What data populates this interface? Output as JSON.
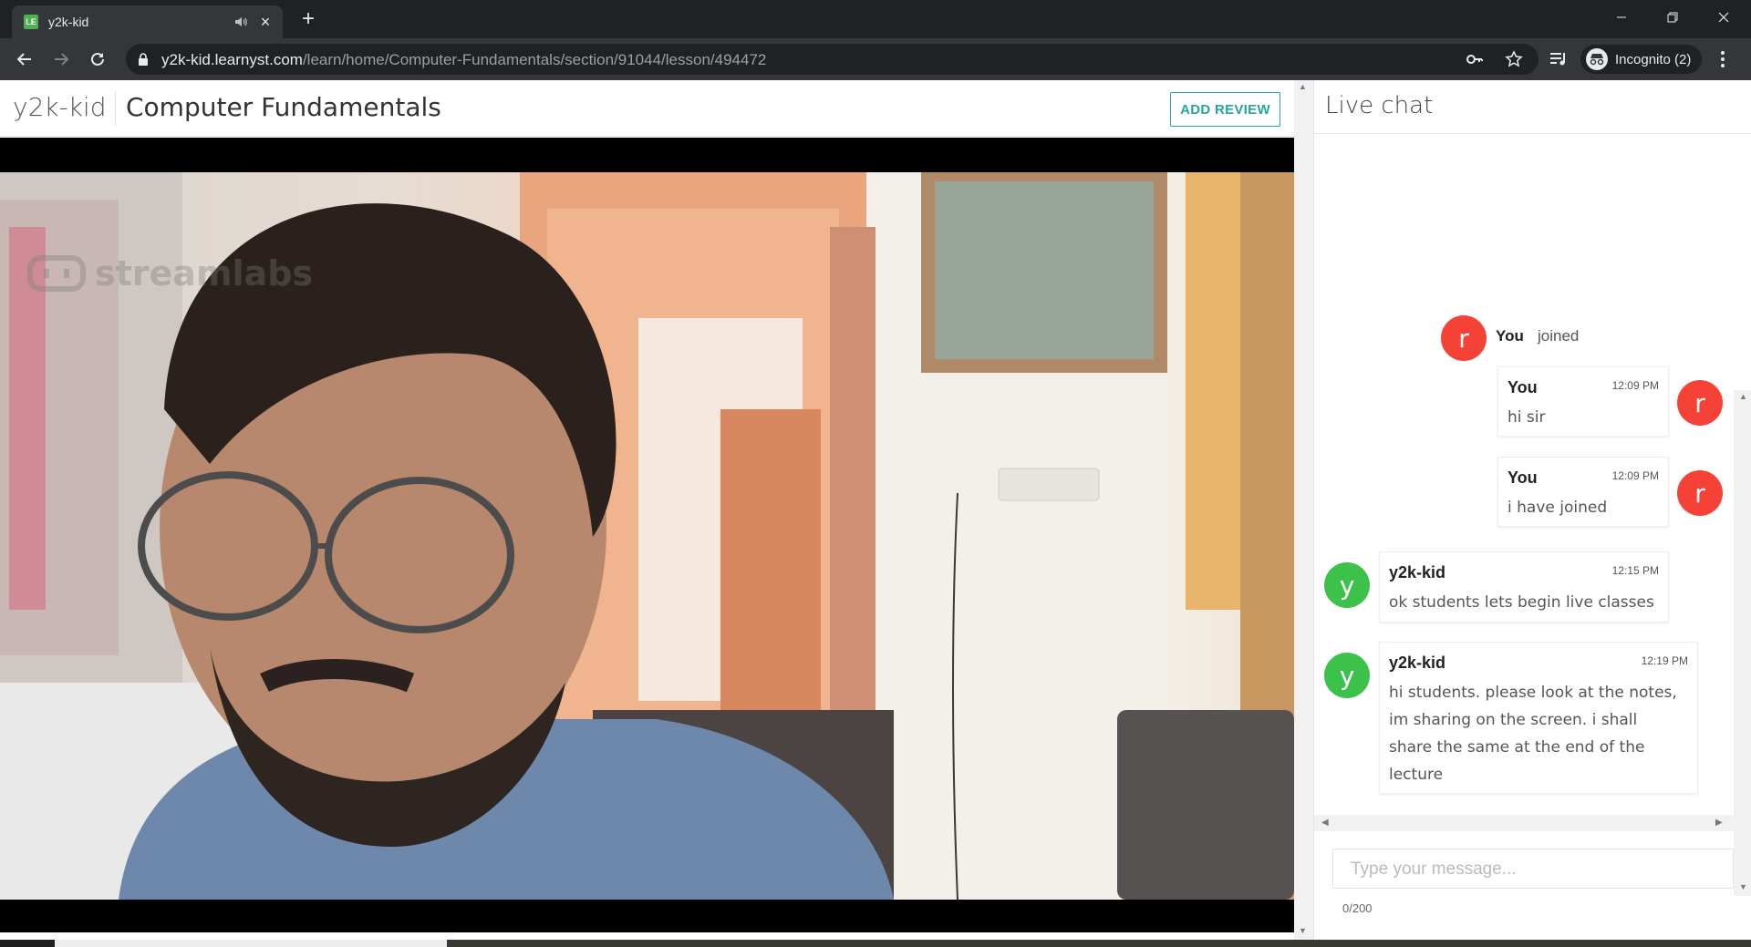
{
  "browser": {
    "tab_title": "y2k-kid",
    "favicon_letter": "LE",
    "url_host": "y2k-kid.learnyst.com",
    "url_path": "/learn/home/Computer-Fundamentals/section/91044/lesson/494472",
    "incognito_label": "Incognito (2)",
    "icons": [
      "back-icon",
      "forward-icon",
      "reload-icon",
      "lock-icon",
      "key-icon",
      "star-icon",
      "media-queue-icon",
      "incognito-icon",
      "menu-icon"
    ]
  },
  "header": {
    "brand": "y2k-kid",
    "course_title": "Computer Fundamentals",
    "review_button": "ADD REVIEW"
  },
  "video": {
    "watermark": "streamlabs"
  },
  "chat": {
    "title": "Live chat",
    "join": {
      "avatar": "r",
      "name": "You",
      "text": "joined"
    },
    "messages": [
      {
        "avatar": "r",
        "name": "You",
        "time": "12:09 PM",
        "lines": [
          "hi sir"
        ]
      },
      {
        "avatar": "r",
        "name": "You",
        "time": "12:09 PM",
        "lines": [
          "i have joined"
        ]
      },
      {
        "avatar": "y",
        "name": "y2k-kid",
        "time": "12:15 PM",
        "lines": [
          "ok students lets begin live classes"
        ]
      },
      {
        "avatar": "y",
        "name": "y2k-kid",
        "time": "12:19 PM",
        "lines": [
          "hi students. please look at the notes,",
          "im sharing on the screen. i shall",
          "share the same at the end of the",
          "lecture"
        ]
      }
    ],
    "input_placeholder": "Type your message...",
    "counter": "0/200"
  },
  "colors": {
    "accent": "#26a69a",
    "avatar_self": "#f44336",
    "avatar_teacher": "#3cc24a",
    "chrome_dark": "#202124",
    "chrome_toolbar": "#35363a"
  }
}
